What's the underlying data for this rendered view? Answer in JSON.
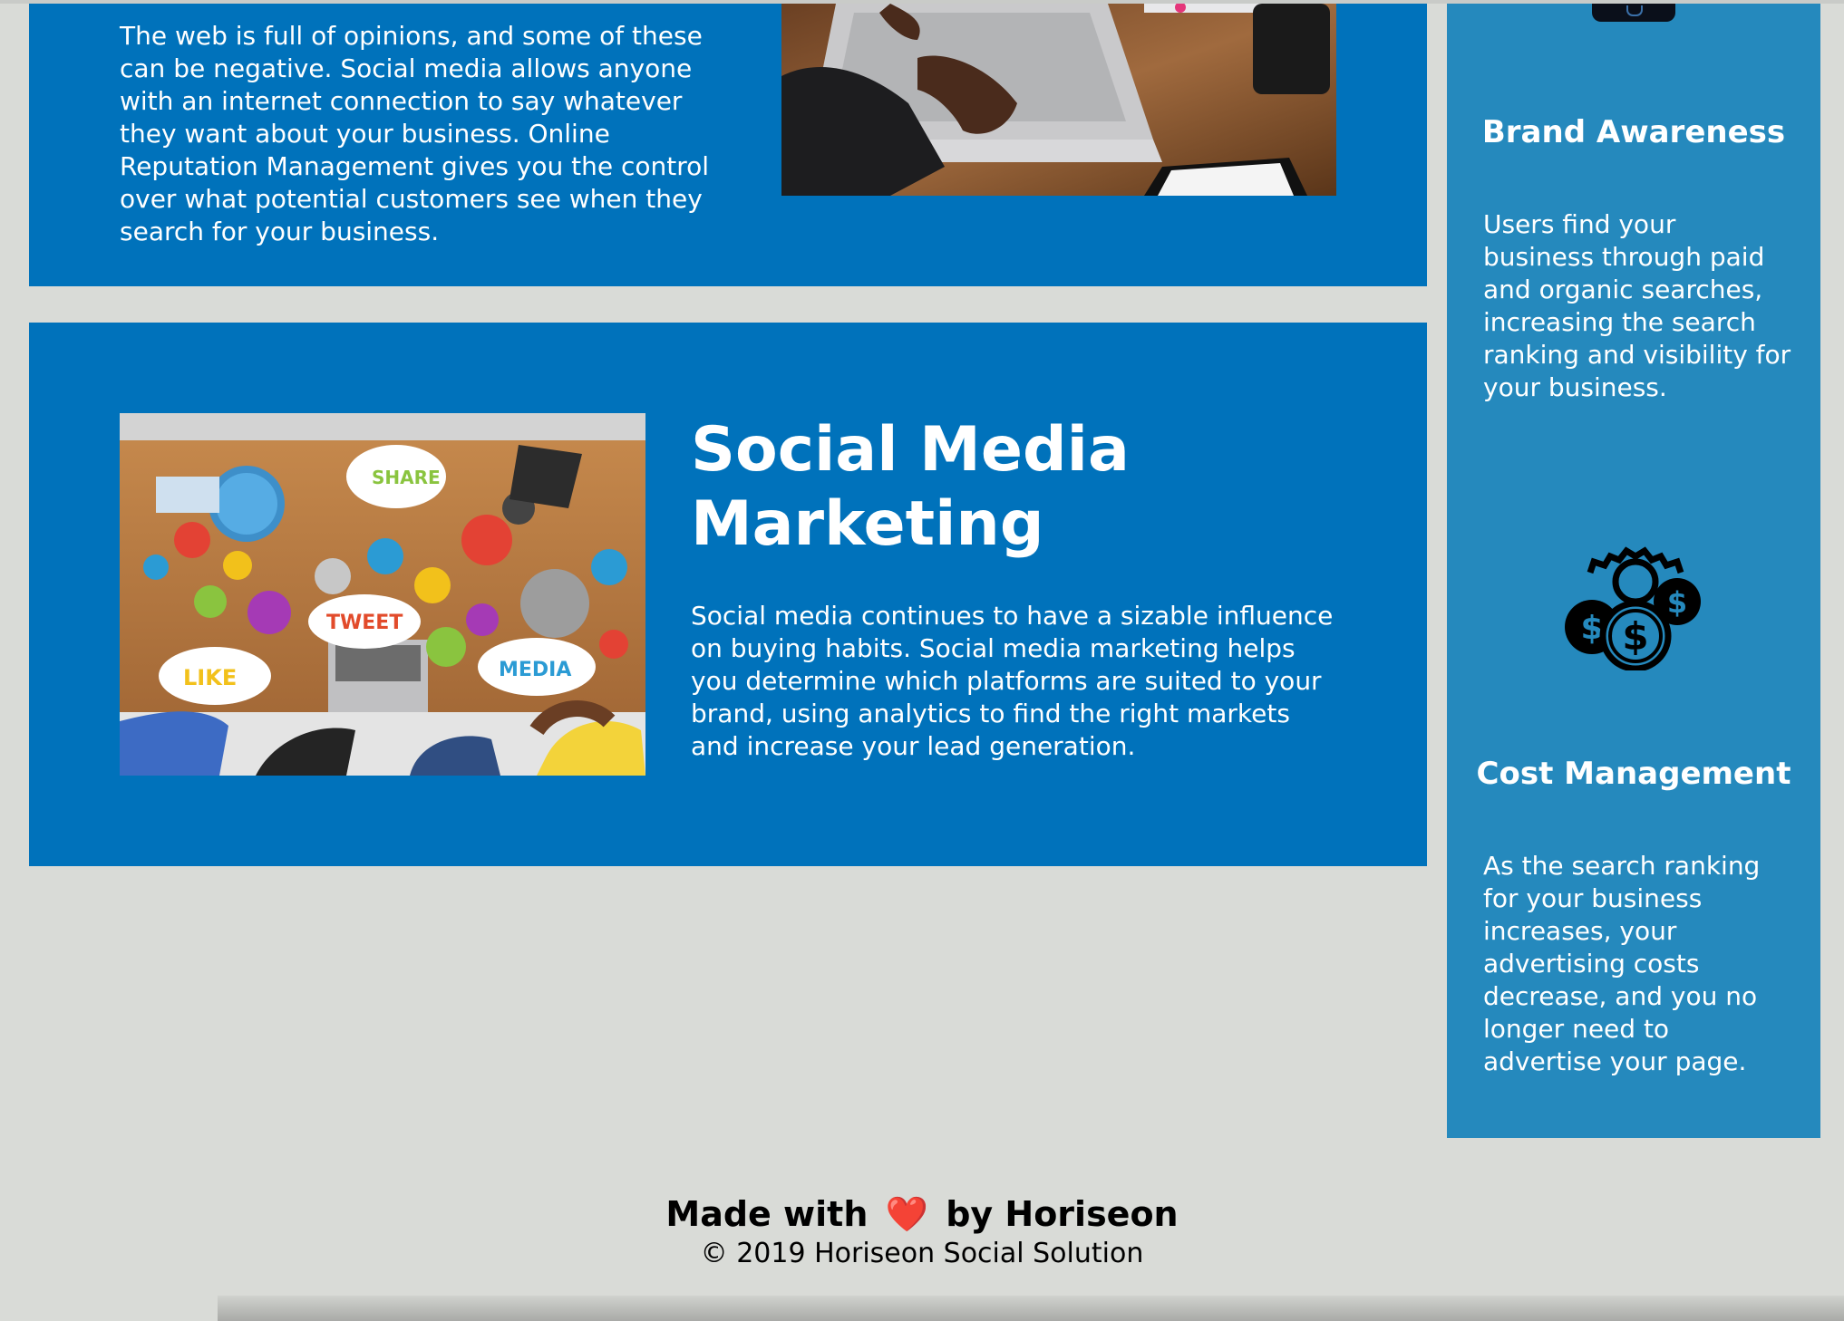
{
  "online_reputation_management": {
    "text": "The web is full of opinions, and some of these can be negative. Social media allows anyone with an internet connection to say whatever they want about your business. Online Reputation Management gives you the control over what potential customers see when they search for your business."
  },
  "social_media_marketing": {
    "title": "Social Media Marketing",
    "text": "Social media continues to have a sizable influence on buying habits. Social media marketing helps you determine which platforms are suited to your brand, using analytics to find the right markets and increase your lead generation.",
    "image_labels": {
      "share": "SHARE",
      "tweet": "TWEET",
      "like": "LIKE",
      "media": "MEDIA"
    }
  },
  "benefits": {
    "brand_awareness": {
      "title": "Brand Awareness",
      "text": "Users find your business through paid and organic searches, increasing the search ranking and visibility for your business."
    },
    "cost_management": {
      "title": "Cost Management",
      "text": "As the search ranking for your business increases, your advertising costs decrease, and you no longer need to advertise your page."
    }
  },
  "footer": {
    "made_with_prefix": "Made with",
    "heart": "❤️",
    "made_with_suffix": "by Horiseon",
    "copyright": "© 2019 Horiseon Social Solution"
  },
  "colors": {
    "section_blue": "#0072bb",
    "aside_blue": "#2589bd",
    "page_background": "#d9dbd7",
    "heart_red": "#e3151e"
  }
}
